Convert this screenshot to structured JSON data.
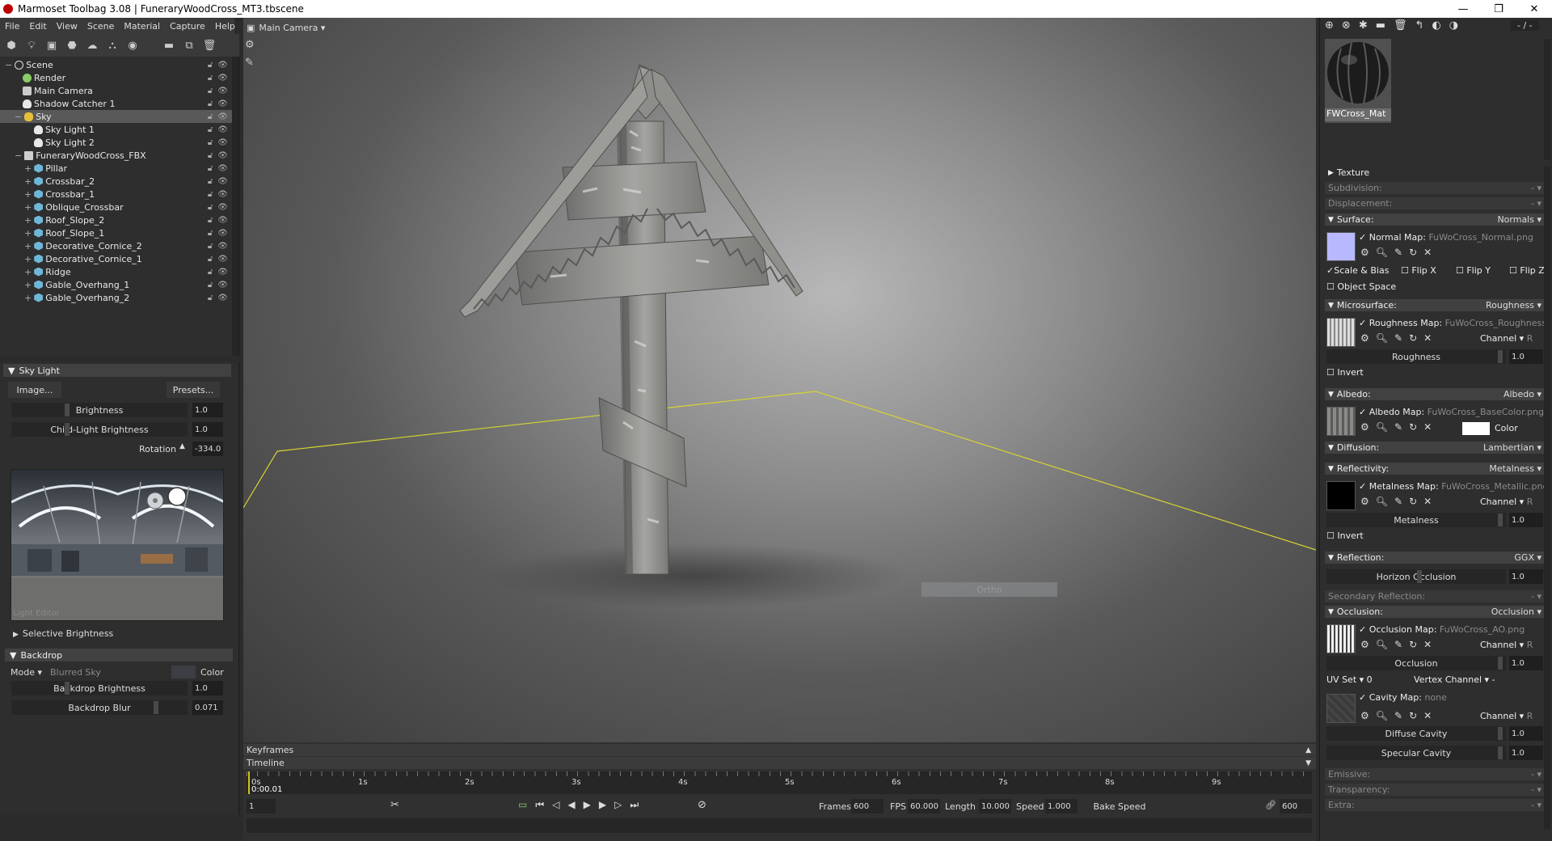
{
  "window": {
    "title": "Marmoset Toolbag 3.08  |  FuneraryWoodCross_MT3.tbscene",
    "min": "—",
    "max": "❐",
    "close": "✕"
  },
  "menu": [
    "File",
    "Edit",
    "View",
    "Scene",
    "Material",
    "Capture",
    "Help"
  ],
  "viewport": {
    "camera_label": "Main Camera ▾",
    "overlay_button": "Ortho"
  },
  "tree": [
    {
      "label": "Scene",
      "indent": 0,
      "icon": "scene-icon"
    },
    {
      "label": "Render",
      "indent": 1,
      "icon": "gear-icon"
    },
    {
      "label": "Main Camera",
      "indent": 1,
      "icon": "camera-icon"
    },
    {
      "label": "Shadow Catcher 1",
      "indent": 1,
      "icon": "shadow-icon"
    },
    {
      "label": "Sky",
      "indent": 1,
      "icon": "sky-icon",
      "selected": true
    },
    {
      "label": "Sky Light 1",
      "indent": 2,
      "icon": "light-icon"
    },
    {
      "label": "Sky Light 2",
      "indent": 2,
      "icon": "light-icon"
    },
    {
      "label": "FuneraryWoodCross_FBX",
      "indent": 1,
      "icon": "fbx-icon"
    },
    {
      "label": "Pillar",
      "indent": 2,
      "icon": "mesh-icon"
    },
    {
      "label": "Crossbar_2",
      "indent": 2,
      "icon": "mesh-icon"
    },
    {
      "label": "Crossbar_1",
      "indent": 2,
      "icon": "mesh-icon"
    },
    {
      "label": "Oblique_Crossbar",
      "indent": 2,
      "icon": "mesh-icon"
    },
    {
      "label": "Roof_Slope_2",
      "indent": 2,
      "icon": "mesh-icon"
    },
    {
      "label": "Roof_Slope_1",
      "indent": 2,
      "icon": "mesh-icon"
    },
    {
      "label": "Decorative_Cornice_2",
      "indent": 2,
      "icon": "mesh-icon"
    },
    {
      "label": "Decorative_Cornice_1",
      "indent": 2,
      "icon": "mesh-icon"
    },
    {
      "label": "Ridge",
      "indent": 2,
      "icon": "mesh-icon"
    },
    {
      "label": "Gable_Overhang_1",
      "indent": 2,
      "icon": "mesh-icon"
    },
    {
      "label": "Gable_Overhang_2",
      "indent": 2,
      "icon": "mesh-icon"
    }
  ],
  "skylight": {
    "header": "Sky Light",
    "image_button": "Image...",
    "presets_button": "Presets...",
    "brightness_label": "Brightness",
    "brightness": "1.0",
    "child_label": "Child-Light Brightness",
    "child": "1.0",
    "rotation_label": "Rotation",
    "rotation": "-334.0",
    "light_editor": "Light Editor",
    "selective": "Selective Brightness"
  },
  "backdrop": {
    "header": "Backdrop",
    "mode_label": "Mode ▾",
    "mode_value": "Blurred Sky",
    "color_label": "Color",
    "brightness_label": "Backdrop Brightness",
    "brightness": "1.0",
    "blur_label": "Backdrop Blur",
    "blur": "0.071"
  },
  "timeline": {
    "keyframes": "Keyframes",
    "timeline": "Timeline",
    "time": "0:00.01",
    "frame": "1",
    "ticks": [
      "0s",
      "1s",
      "2s",
      "3s",
      "4s",
      "5s",
      "6s",
      "7s",
      "8s",
      "9s"
    ],
    "frames_label": "Frames",
    "frames": "600",
    "fps_label": "FPS",
    "fps": "60.000",
    "length_label": "Length",
    "length": "10.000",
    "speed_label": "Speed",
    "speed": "1.000",
    "bake": "Bake Speed",
    "end": "600"
  },
  "material": {
    "name": "FWCross_Mat",
    "page": "- / -",
    "texture": "Texture",
    "subdivision": "Subdivision:",
    "displacement": "Displacement:",
    "surface": "Surface:",
    "surface_val": "Normals ▾",
    "normal_map": "Normal Map:",
    "normal_file": "FuWoCross_Normal.png",
    "scale_bias": "Scale & Bias",
    "flipx": "Flip X",
    "flipy": "Flip Y",
    "flipz": "Flip Z",
    "object_space": "Object Space",
    "micro": "Microsurface:",
    "micro_val": "Roughness ▾",
    "rough_map": "Roughness Map:",
    "rough_file": "FuWoCross_Roughness.png",
    "channel": "Channel ▾",
    "channel_r": "R",
    "roughness": "Roughness",
    "roughness_val": "1.0",
    "invert": "Invert",
    "albedo": "Albedo:",
    "albedo_val": "Albedo ▾",
    "albedo_map": "Albedo Map:",
    "albedo_file": "FuWoCross_BaseColor.png",
    "color": "Color",
    "diffusion": "Diffusion:",
    "diffusion_val": "Lambertian ▾",
    "reflectivity": "Reflectivity:",
    "reflectivity_val": "Metalness ▾",
    "metal_map": "Metalness Map:",
    "metal_file": "FuWoCross_Metallic.png",
    "metalness": "Metalness",
    "metalness_val": "1.0",
    "reflection": "Reflection:",
    "reflection_val": "GGX ▾",
    "horizon": "Horizon Occlusion",
    "horizon_val": "1.0",
    "secondary": "Secondary Reflection:",
    "occlusion": "Occlusion:",
    "occlusion_val": "Occlusion ▾",
    "occ_map": "Occlusion Map:",
    "occ_file": "FuWoCross_AO.png",
    "occlusion_lbl": "Occlusion",
    "occlusion_num": "1.0",
    "uvset": "UV Set ▾ 0",
    "vertex": "Vertex Channel ▾ -",
    "cavity_map": "Cavity Map:",
    "cavity_file": "none",
    "diffuse_cavity": "Diffuse Cavity",
    "diffuse_cavity_val": "1.0",
    "specular_cavity": "Specular Cavity",
    "specular_cavity_val": "1.0",
    "emissive": "Emissive:",
    "transparency": "Transparency:",
    "extra": "Extra:",
    "dash": "- ▾"
  }
}
